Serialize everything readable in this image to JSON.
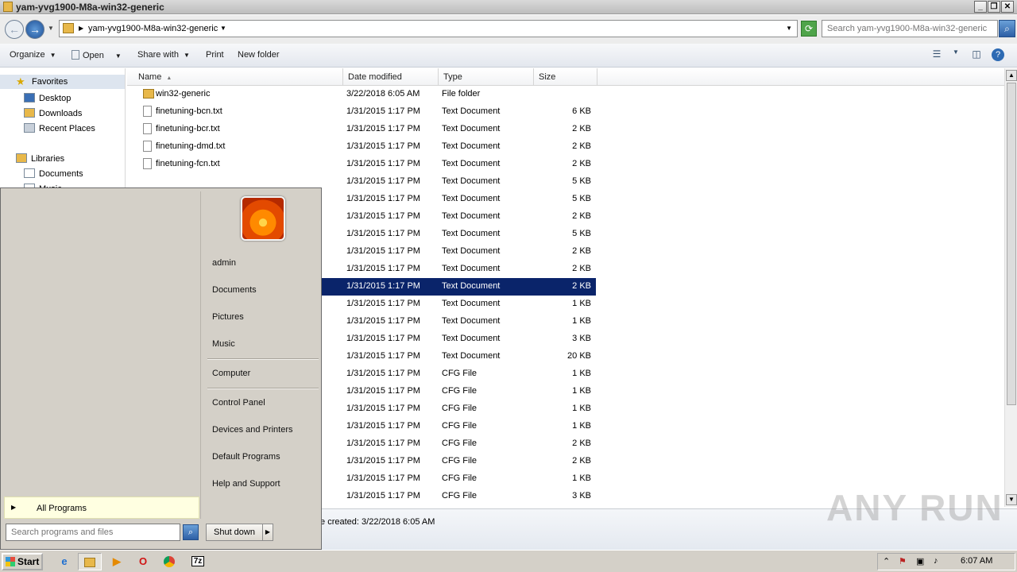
{
  "window": {
    "title": "yam-yvg1900-M8a-win32-generic"
  },
  "address": {
    "path": "yam-yvg1900-M8a-win32-generic",
    "search_placeholder": "Search yam-yvg1900-M8a-win32-generic"
  },
  "toolbar": {
    "organize": "Organize",
    "open": "Open",
    "share_with": "Share with",
    "print": "Print",
    "new_folder": "New folder"
  },
  "navpane": {
    "favorites": "Favorites",
    "desktop": "Desktop",
    "downloads": "Downloads",
    "recent_places": "Recent Places",
    "libraries": "Libraries",
    "documents": "Documents",
    "music_partial": "Music"
  },
  "columns": {
    "name": "Name",
    "date": "Date modified",
    "type": "Type",
    "size": "Size"
  },
  "files": [
    {
      "name": "win32-generic",
      "date": "3/22/2018 6:05 AM",
      "type": "File folder",
      "size": "",
      "icon": "folder-icon"
    },
    {
      "name": "finetuning-bcn.txt",
      "date": "1/31/2015 1:17 PM",
      "type": "Text Document",
      "size": "6 KB",
      "icon": "text-file-icon"
    },
    {
      "name": "finetuning-bcr.txt",
      "date": "1/31/2015 1:17 PM",
      "type": "Text Document",
      "size": "2 KB",
      "icon": "text-file-icon"
    },
    {
      "name": "finetuning-dmd.txt",
      "date": "1/31/2015 1:17 PM",
      "type": "Text Document",
      "size": "2 KB",
      "icon": "text-file-icon"
    },
    {
      "name": "finetuning-fcn.txt",
      "date": "1/31/2015 1:17 PM",
      "type": "Text Document",
      "size": "2 KB",
      "icon": "text-file-icon"
    },
    {
      "name": "",
      "date": "1/31/2015 1:17 PM",
      "type": "Text Document",
      "size": "5 KB",
      "icon": "text-file-icon"
    },
    {
      "name": "",
      "date": "1/31/2015 1:17 PM",
      "type": "Text Document",
      "size": "5 KB",
      "icon": "text-file-icon"
    },
    {
      "name": "",
      "date": "1/31/2015 1:17 PM",
      "type": "Text Document",
      "size": "2 KB",
      "icon": "text-file-icon"
    },
    {
      "name": "",
      "date": "1/31/2015 1:17 PM",
      "type": "Text Document",
      "size": "5 KB",
      "icon": "text-file-icon"
    },
    {
      "name": "",
      "date": "1/31/2015 1:17 PM",
      "type": "Text Document",
      "size": "2 KB",
      "icon": "text-file-icon"
    },
    {
      "name": "",
      "date": "1/31/2015 1:17 PM",
      "type": "Text Document",
      "size": "2 KB",
      "icon": "text-file-icon"
    },
    {
      "name": "",
      "date": "1/31/2015 1:17 PM",
      "type": "Text Document",
      "size": "2 KB",
      "icon": "text-file-icon",
      "selected": true
    },
    {
      "name": "",
      "date": "1/31/2015 1:17 PM",
      "type": "Text Document",
      "size": "1 KB",
      "icon": "text-file-icon"
    },
    {
      "name": "",
      "date": "1/31/2015 1:17 PM",
      "type": "Text Document",
      "size": "1 KB",
      "icon": "text-file-icon"
    },
    {
      "name": "",
      "date": "1/31/2015 1:17 PM",
      "type": "Text Document",
      "size": "3 KB",
      "icon": "text-file-icon"
    },
    {
      "name": "",
      "date": "1/31/2015 1:17 PM",
      "type": "Text Document",
      "size": "20 KB",
      "icon": "text-file-icon"
    },
    {
      "name": "",
      "date": "1/31/2015 1:17 PM",
      "type": "CFG File",
      "size": "1 KB",
      "icon": "cfg-file-icon"
    },
    {
      "name": "",
      "date": "1/31/2015 1:17 PM",
      "type": "CFG File",
      "size": "1 KB",
      "icon": "cfg-file-icon"
    },
    {
      "name": "",
      "date": "1/31/2015 1:17 PM",
      "type": "CFG File",
      "size": "1 KB",
      "icon": "cfg-file-icon"
    },
    {
      "name": "",
      "date": "1/31/2015 1:17 PM",
      "type": "CFG File",
      "size": "1 KB",
      "icon": "cfg-file-icon"
    },
    {
      "name": "",
      "date": "1/31/2015 1:17 PM",
      "type": "CFG File",
      "size": "2 KB",
      "icon": "cfg-file-icon"
    },
    {
      "name": "",
      "date": "1/31/2015 1:17 PM",
      "type": "CFG File",
      "size": "2 KB",
      "icon": "cfg-file-icon"
    },
    {
      "name": "",
      "date": "1/31/2015 1:17 PM",
      "type": "CFG File",
      "size": "1 KB",
      "icon": "cfg-file-icon"
    },
    {
      "name": "",
      "date": "1/31/2015 1:17 PM",
      "type": "CFG File",
      "size": "3 KB",
      "icon": "cfg-file-icon"
    }
  ],
  "details": {
    "text": "te created: 3/22/2018 6:05 AM"
  },
  "startmenu": {
    "user": "admin",
    "documents": "Documents",
    "pictures": "Pictures",
    "music": "Music",
    "computer": "Computer",
    "control_panel": "Control Panel",
    "devices_printers": "Devices and Printers",
    "default_programs": "Default Programs",
    "help_support": "Help and Support",
    "all_programs": "All Programs",
    "search_placeholder": "Search programs and files",
    "shutdown": "Shut down"
  },
  "taskbar": {
    "start": "Start",
    "clock": "6:07 AM"
  },
  "watermark": "ANY RUN"
}
